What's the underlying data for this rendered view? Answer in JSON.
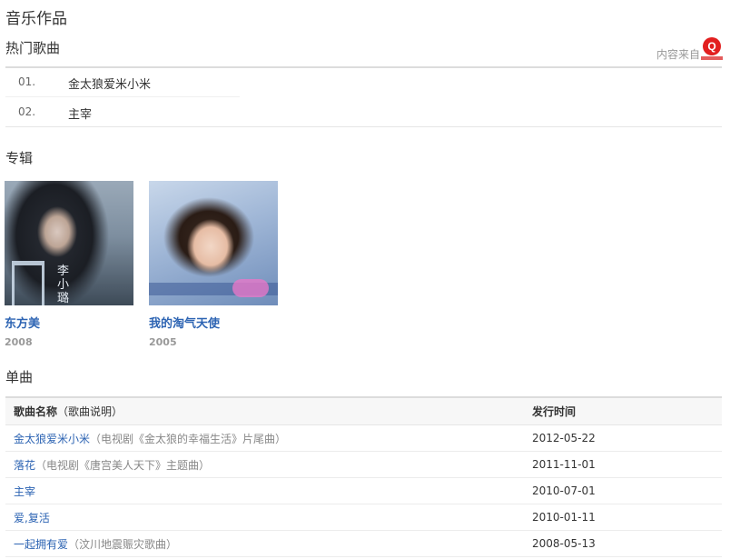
{
  "page_title": "音乐作品",
  "hot_songs": {
    "title": "热门歌曲",
    "source_label": "内容来自",
    "items": [
      {
        "num": "01.",
        "name": "金太狼爱米小米"
      },
      {
        "num": "02.",
        "name": "主宰"
      }
    ]
  },
  "albums": {
    "title": "专辑",
    "items": [
      {
        "title": "东方美",
        "year": "2008",
        "cover_text": "李小璐"
      },
      {
        "title": "我的淘气天使",
        "year": "2005"
      }
    ]
  },
  "singles": {
    "title": "单曲",
    "header_name": "歌曲名称",
    "header_desc": "（歌曲说明）",
    "header_date": "发行时间",
    "rows": [
      {
        "name": "金太狼爱米小米",
        "desc": "（电视剧《金太狼的幸福生活》片尾曲）",
        "date": "2012-05-22"
      },
      {
        "name": "落花",
        "desc": "（电视剧《唐宫美人天下》主题曲）",
        "date": "2011-11-01"
      },
      {
        "name": "主宰",
        "desc": "",
        "date": "2010-07-01"
      },
      {
        "name": "爱,复活",
        "desc": "",
        "date": "2010-01-11"
      },
      {
        "name": "一起拥有爱",
        "desc": "（汶川地震赈灾歌曲）",
        "date": "2008-05-13"
      }
    ]
  },
  "colors": {
    "link": "#2d64b3",
    "logo": "#e21f1f"
  }
}
